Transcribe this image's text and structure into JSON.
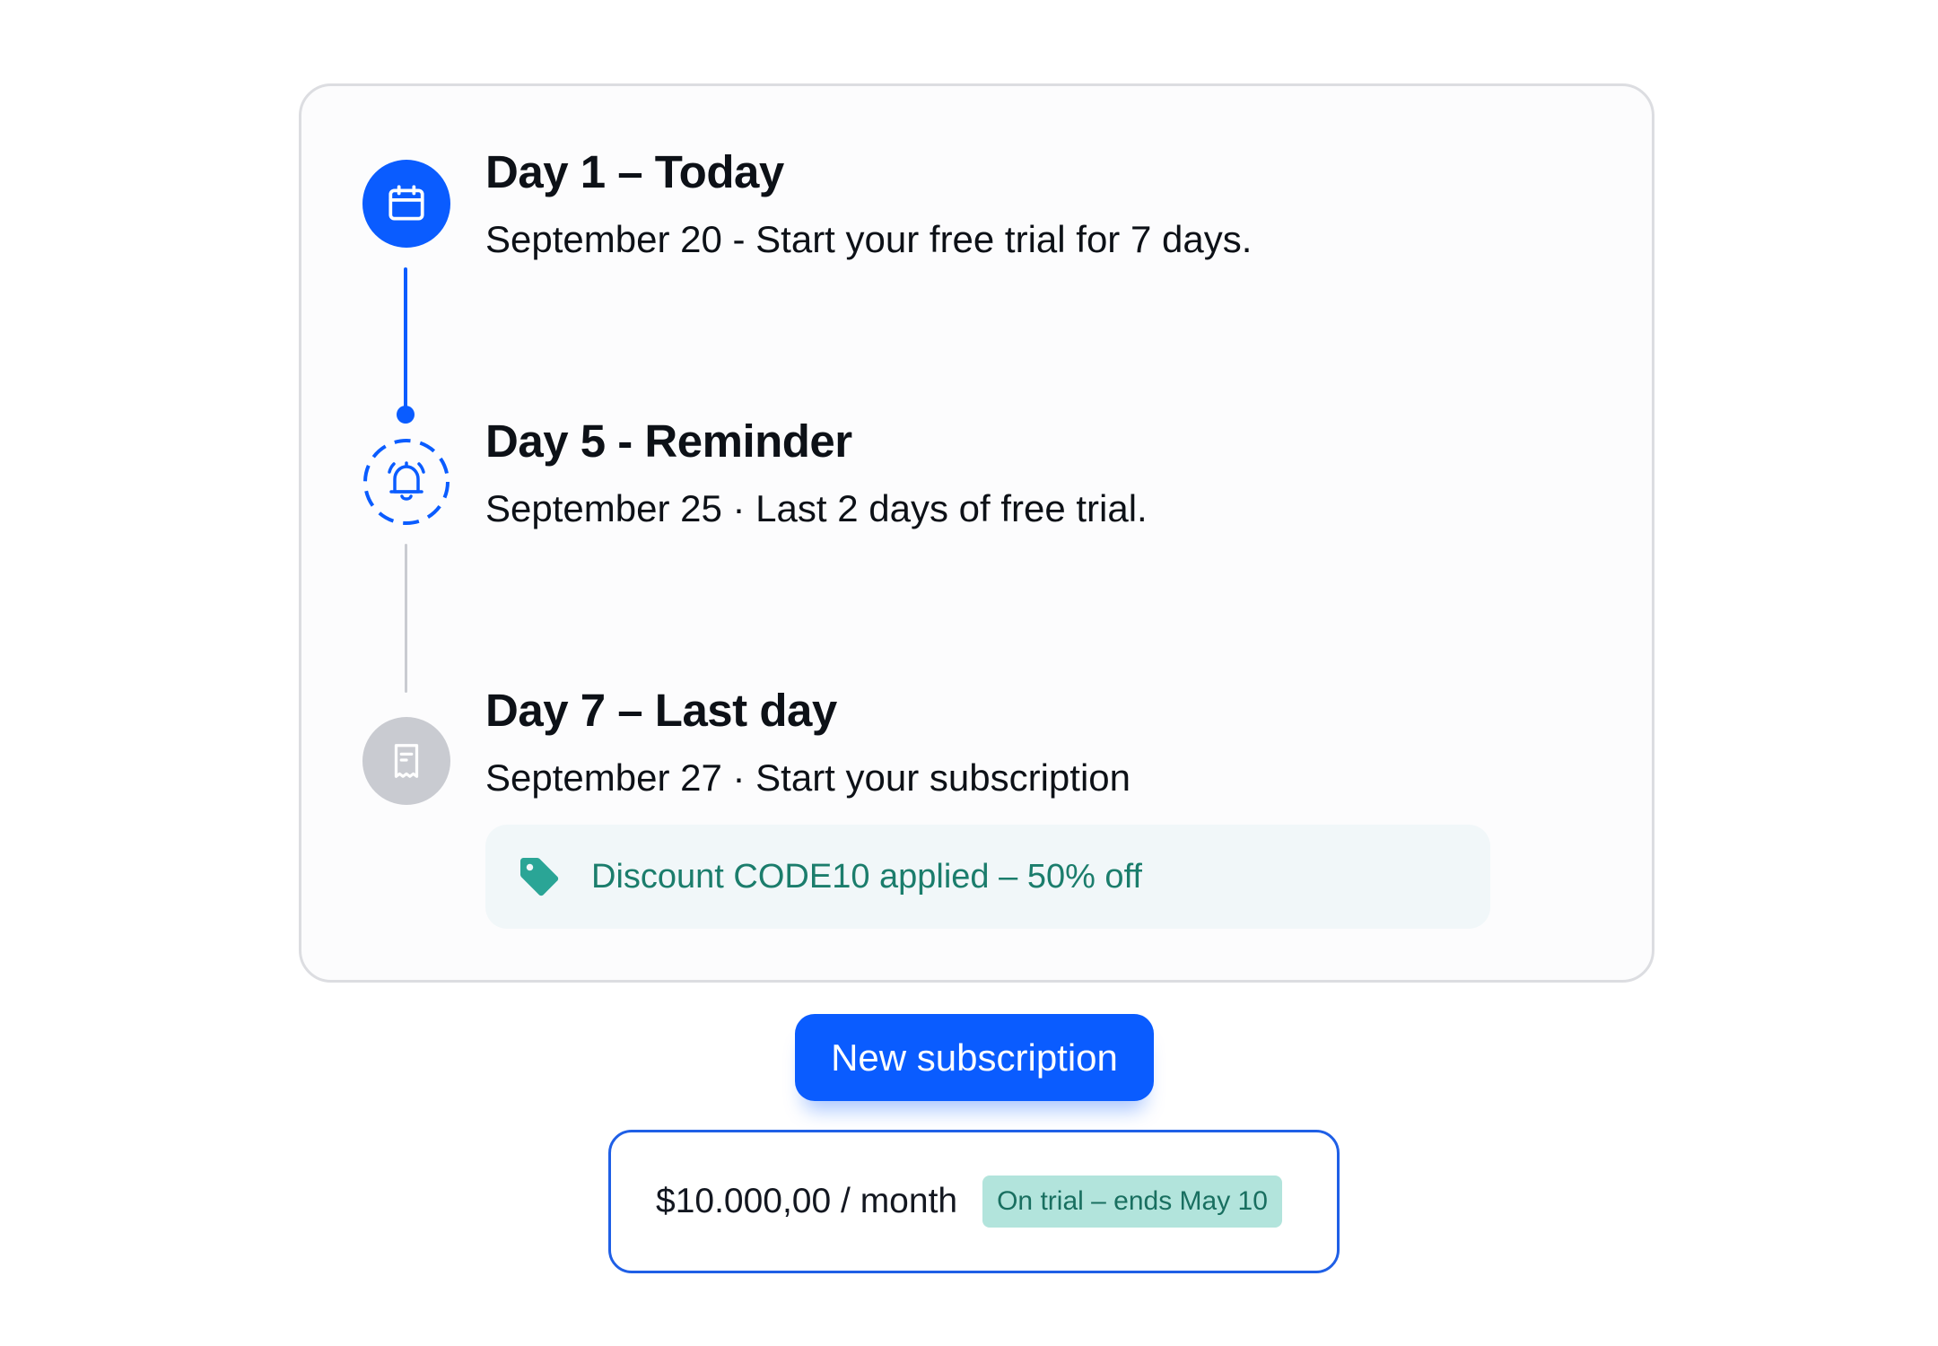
{
  "timeline": {
    "steps": [
      {
        "title": "Day 1 – Today",
        "description": "September 20 - Start your free trial for 7 days.",
        "icon": "calendar-icon",
        "state": "active"
      },
      {
        "title": "Day 5 - Reminder",
        "description": "September 25 · Last 2 days of free trial.",
        "icon": "bell-icon",
        "state": "upcoming"
      },
      {
        "title": "Day 7 – Last day",
        "description": "September 27 · Start your subscription",
        "icon": "receipt-icon",
        "state": "pending"
      }
    ],
    "discount": {
      "icon": "tag-icon",
      "text": "Discount CODE10 applied – 50% off"
    }
  },
  "actions": {
    "new_subscription_label": "New subscription"
  },
  "plan": {
    "price": "$10.000,00 / month",
    "badge": "On trial – ends May 10"
  },
  "colors": {
    "primary": "#0a5cff",
    "inactive": "#c9cbd1",
    "discount_text": "#1b7d6c",
    "discount_bg": "#f1f7f9",
    "badge_bg": "#b2e4dc",
    "plan_border": "#1f5fe6"
  }
}
